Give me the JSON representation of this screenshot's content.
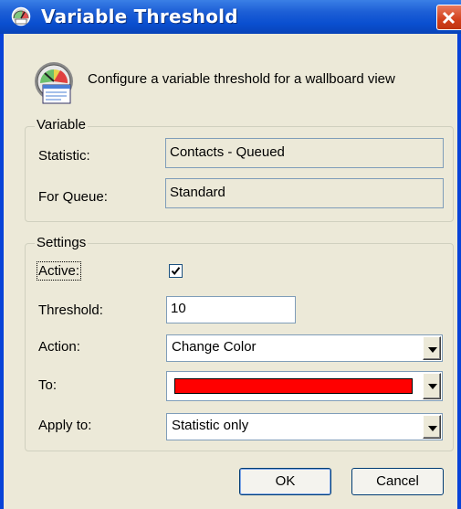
{
  "window": {
    "title": "Variable Threshold",
    "close_icon": "close-x"
  },
  "header": {
    "icon": "gauge-report-icon",
    "description": "Configure a variable threshold for a wallboard view"
  },
  "variable_group": {
    "legend": "Variable",
    "statistic_label": "Statistic:",
    "statistic_value": "Contacts - Queued",
    "queue_label": "For Queue:",
    "queue_value": "Standard"
  },
  "settings_group": {
    "legend": "Settings",
    "active_label": "Active:",
    "active_checked": true,
    "threshold_label": "Threshold:",
    "threshold_value": "10",
    "action_label": "Action:",
    "action_value": "Change Color",
    "to_label": "To:",
    "to_color": "#ff0000",
    "apply_label": "Apply to:",
    "apply_value": "Statistic only"
  },
  "buttons": {
    "ok": "OK",
    "cancel": "Cancel"
  },
  "colors": {
    "title_bar": "#0a4fd0",
    "dialog_bg": "#ece9d8",
    "close_button": "#d2401c"
  }
}
